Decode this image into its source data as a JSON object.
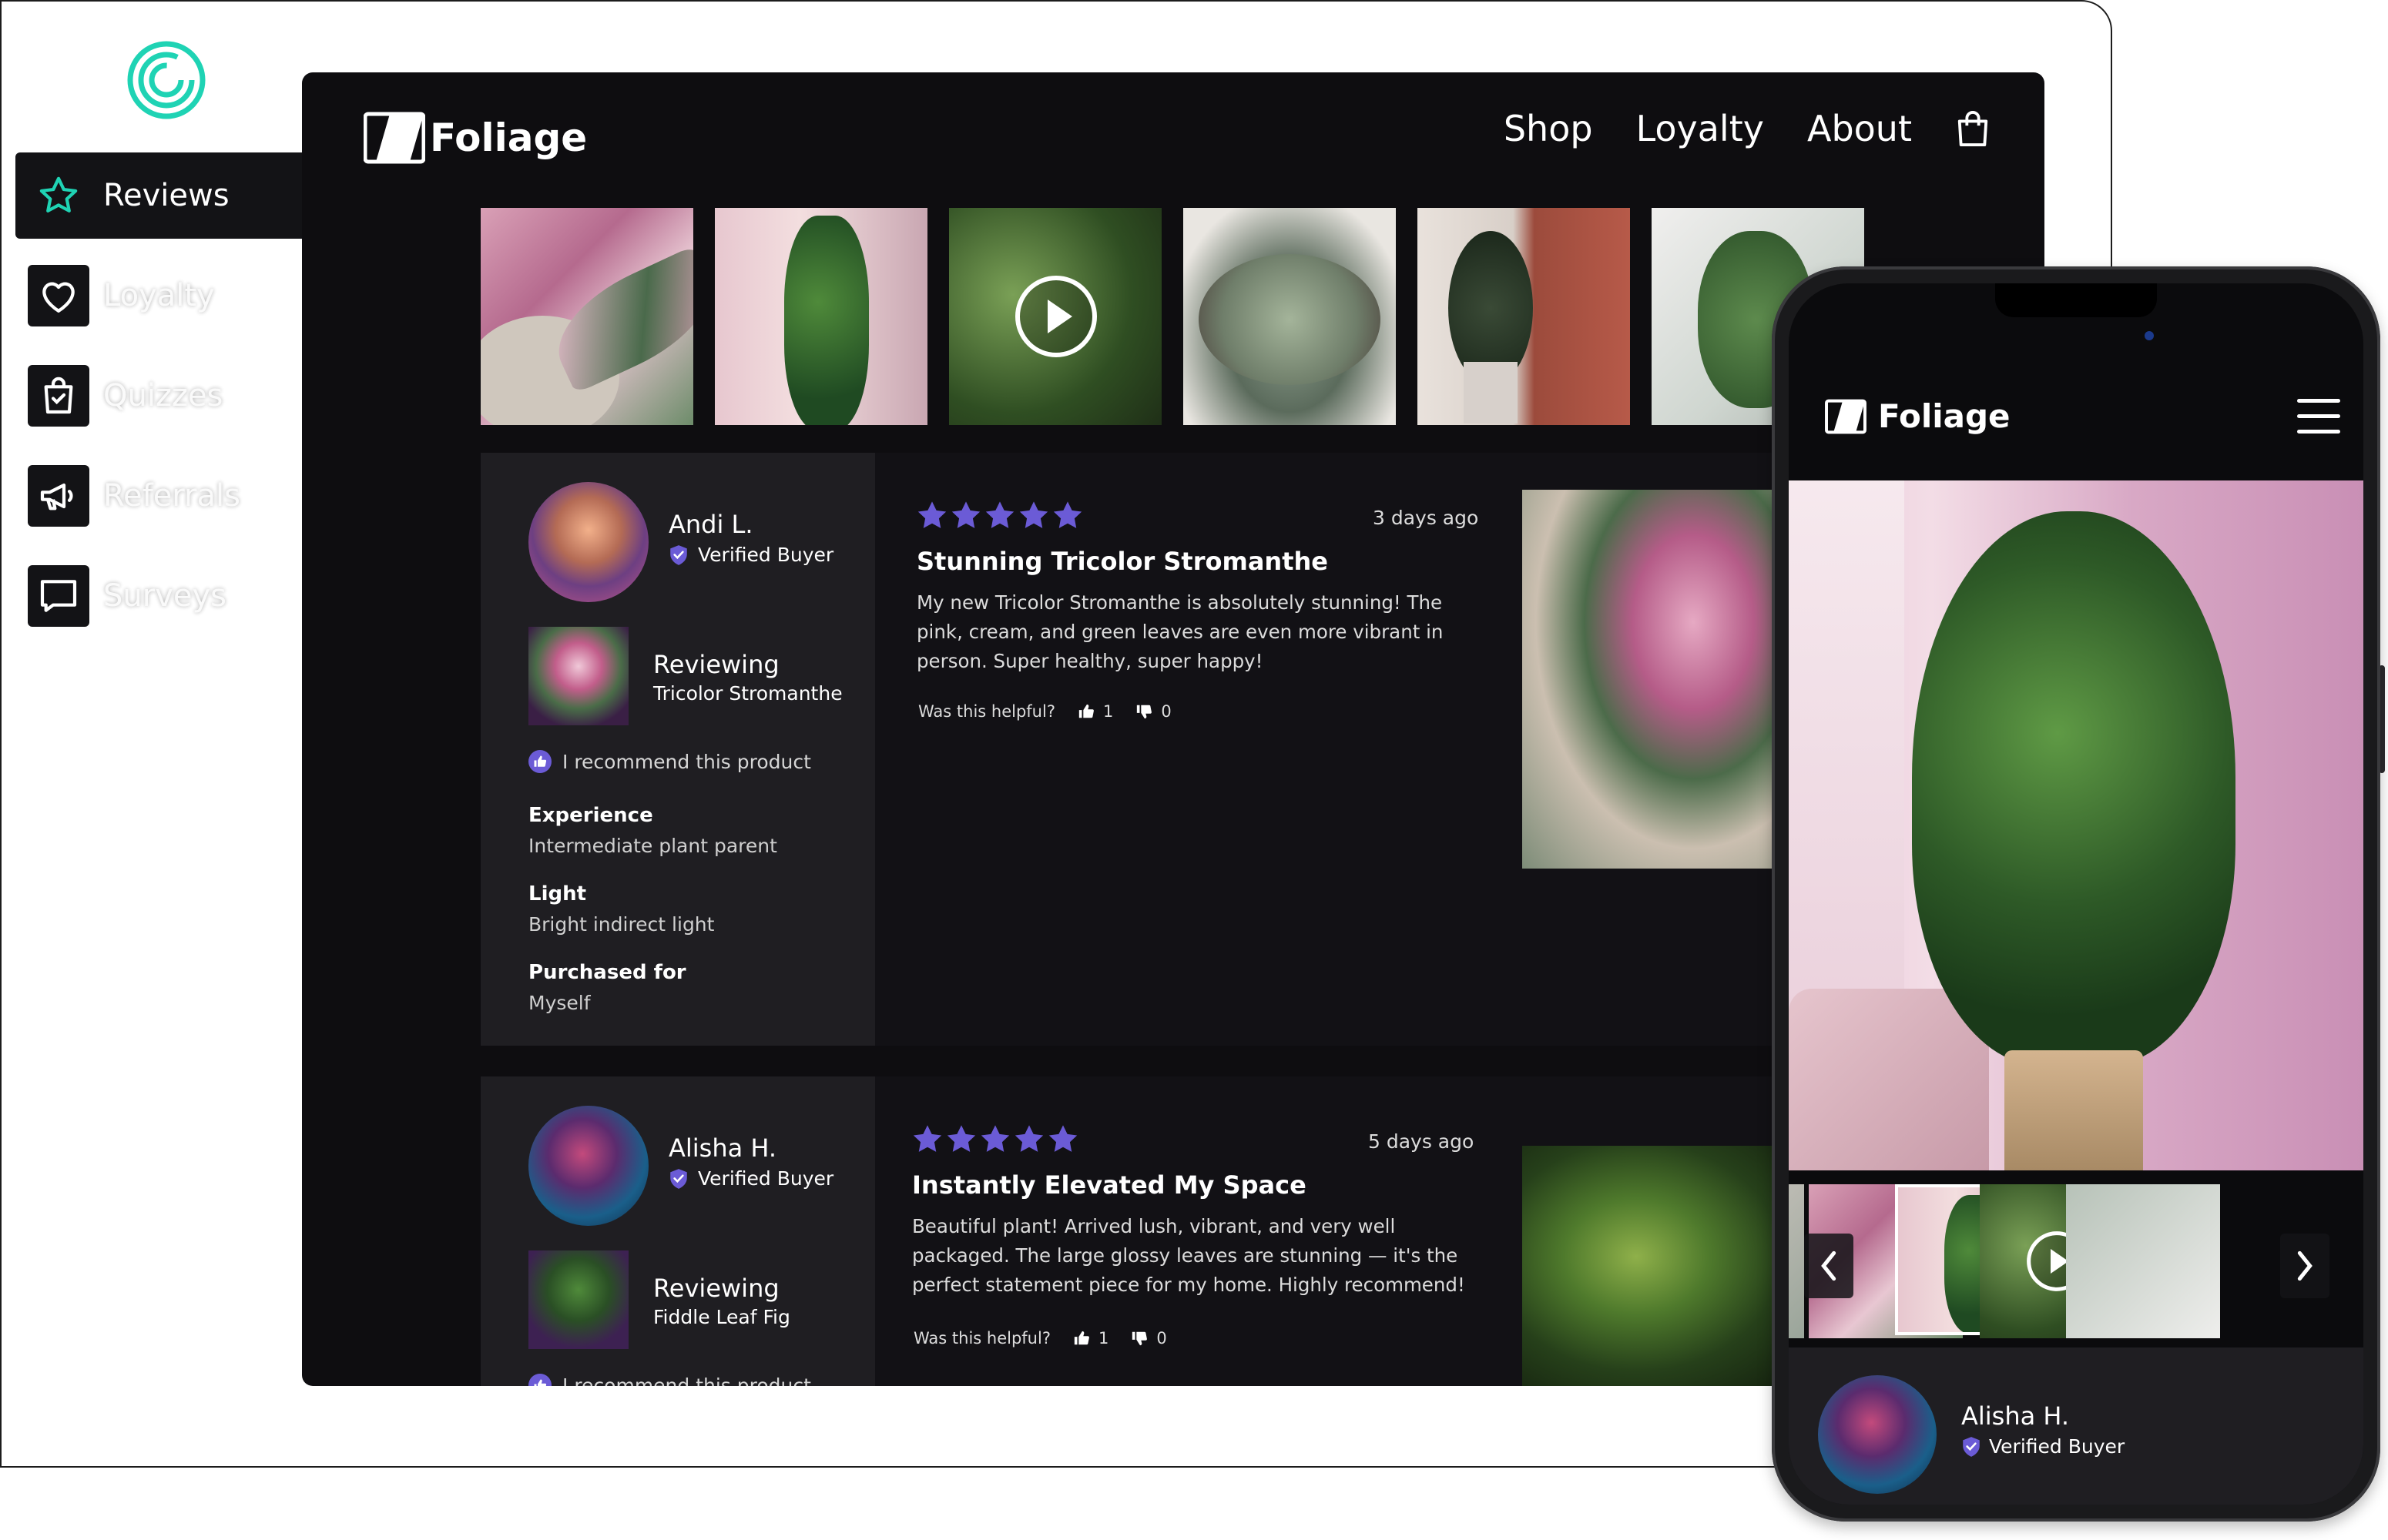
{
  "sidebar": {
    "items": [
      {
        "label": "Reviews",
        "icon": "star-icon"
      },
      {
        "label": "Loyalty",
        "icon": "heart-icon"
      },
      {
        "label": "Quizzes",
        "icon": "shopping-bag-check-icon"
      },
      {
        "label": "Referrals",
        "icon": "megaphone-icon"
      },
      {
        "label": "Surveys",
        "icon": "message-square-icon"
      }
    ]
  },
  "site": {
    "brand": "Foliage",
    "nav": [
      "Shop",
      "Loyalty",
      "About"
    ]
  },
  "reviews": [
    {
      "name": "Andi L.",
      "verified": "Verified Buyer",
      "reviewing_label": "Reviewing",
      "product": "Tricolor Stromanthe",
      "recommend": "I recommend this product",
      "attributes": [
        {
          "label": "Experience",
          "value": "Intermediate plant parent"
        },
        {
          "label": "Light",
          "value": "Bright indirect light"
        },
        {
          "label": "Purchased for",
          "value": "Myself"
        }
      ],
      "rating": 5,
      "time_ago": "3 days ago",
      "title": "Stunning Tricolor Stromanthe",
      "body": "My new Tricolor Stromanthe is absolutely stunning! The pink, cream, and green leaves are even more vibrant in person. Super healthy, super happy!",
      "helpful_label": "Was this helpful?",
      "helpful_yes": "1",
      "helpful_no": "0"
    },
    {
      "name": "Alisha H.",
      "verified": "Verified Buyer",
      "reviewing_label": "Reviewing",
      "product": "Fiddle Leaf Fig",
      "recommend": "I recommend this product",
      "rating": 5,
      "time_ago": "5 days ago",
      "title": "Instantly Elevated My Space",
      "body": "Beautiful plant! Arrived lush, vibrant, and very well packaged. The large glossy leaves are stunning — it's the perfect statement piece for my home. Highly recommend!",
      "helpful_label": "Was this helpful?",
      "helpful_yes": "1",
      "helpful_no": "0"
    }
  ],
  "phone": {
    "brand": "Foliage",
    "reviewer": {
      "name": "Alisha H.",
      "verified": "Verified Buyer"
    }
  },
  "colors": {
    "accent_teal": "#1fd3b4",
    "star_purple": "#6b5bd6",
    "background_dark": "#0e0d10",
    "panel_dark": "#1f1e22"
  }
}
